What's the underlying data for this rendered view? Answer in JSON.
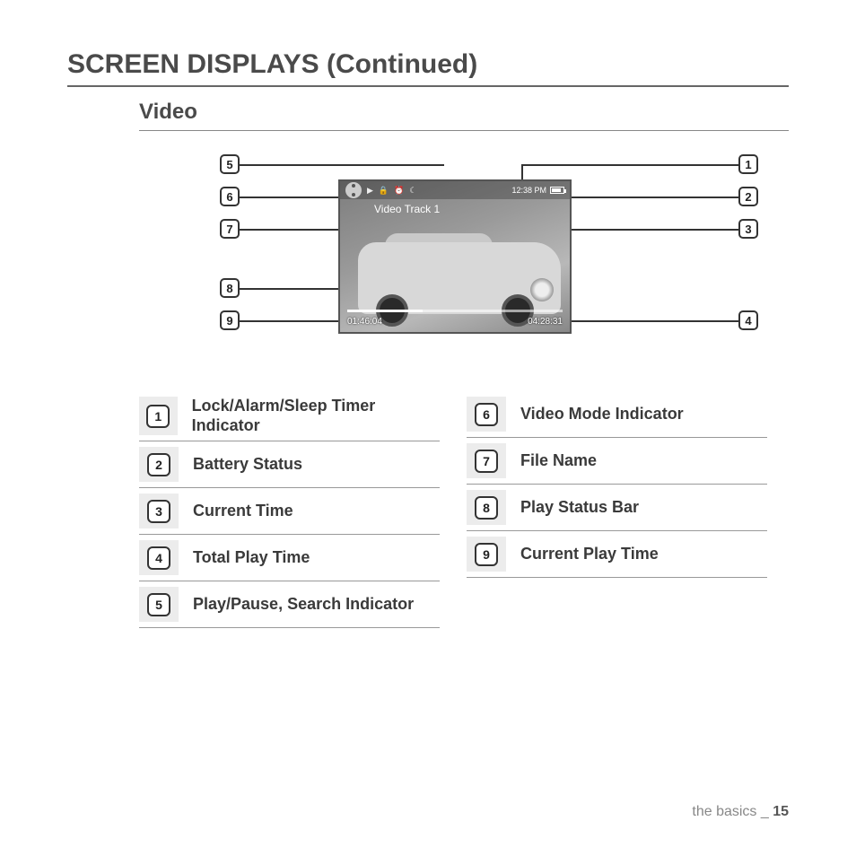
{
  "page_title": "SCREEN DISPLAYS (Continued)",
  "section_title": "Video",
  "screen": {
    "file_name": "Video Track 1",
    "clock": "12:38 PM",
    "current_play_time": "01:46:04",
    "total_play_time": "04:28:31"
  },
  "callouts": {
    "1": "1",
    "2": "2",
    "3": "3",
    "4": "4",
    "5": "5",
    "6": "6",
    "7": "7",
    "8": "8",
    "9": "9"
  },
  "legend_left": [
    {
      "n": "1",
      "label": "Lock/Alarm/Sleep Timer Indicator"
    },
    {
      "n": "2",
      "label": "Battery Status"
    },
    {
      "n": "3",
      "label": "Current Time"
    },
    {
      "n": "4",
      "label": "Total Play Time"
    },
    {
      "n": "5",
      "label": "Play/Pause, Search Indicator"
    }
  ],
  "legend_right": [
    {
      "n": "6",
      "label": "Video Mode Indicator"
    },
    {
      "n": "7",
      "label": "File Name"
    },
    {
      "n": "8",
      "label": "Play Status Bar"
    },
    {
      "n": "9",
      "label": "Current Play Time"
    }
  ],
  "footer": {
    "section": "the basics _ ",
    "page": "15"
  }
}
